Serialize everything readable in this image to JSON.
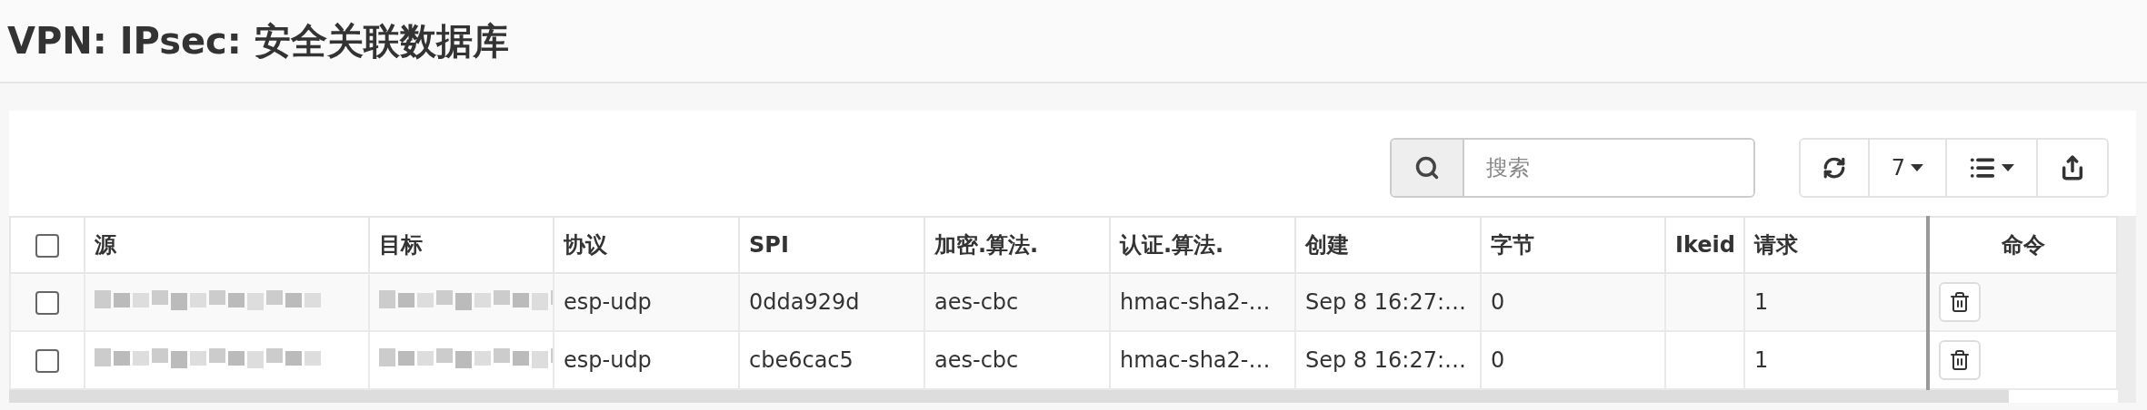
{
  "page_title": "VPN: IPsec: 安全关联数据库",
  "toolbar": {
    "search": {
      "placeholder": "搜索"
    },
    "page_size": "7"
  },
  "table": {
    "select_all": {
      "checked": false
    },
    "columns": [
      "源",
      "目标",
      "协议",
      "SPI",
      "加密.算法.",
      "认证.算法.",
      "创建",
      "字节",
      "Ikeid",
      "请求"
    ],
    "command_column": "命令",
    "rows": [
      {
        "checked": false,
        "cells": [
          {
            "kind": "redacted"
          },
          {
            "kind": "redacted"
          },
          {
            "kind": "text",
            "text": "esp-udp"
          },
          {
            "kind": "text",
            "text": "0dda929d"
          },
          {
            "kind": "text",
            "text": "aes-cbc"
          },
          {
            "kind": "text",
            "text": "hmac-sha2-…"
          },
          {
            "kind": "text",
            "text": "Sep 8 16:27:…"
          },
          {
            "kind": "text",
            "text": "0"
          },
          {
            "kind": "text",
            "text": ""
          },
          {
            "kind": "text",
            "text": "1"
          }
        ]
      },
      {
        "checked": false,
        "cells": [
          {
            "kind": "redacted"
          },
          {
            "kind": "redacted"
          },
          {
            "kind": "text",
            "text": "esp-udp"
          },
          {
            "kind": "text",
            "text": "cbe6cac5"
          },
          {
            "kind": "text",
            "text": "aes-cbc"
          },
          {
            "kind": "text",
            "text": "hmac-sha2-…"
          },
          {
            "kind": "text",
            "text": "Sep 8 16:27:…"
          },
          {
            "kind": "text",
            "text": "0"
          },
          {
            "kind": "text",
            "text": ""
          },
          {
            "kind": "text",
            "text": "1"
          }
        ]
      }
    ]
  }
}
